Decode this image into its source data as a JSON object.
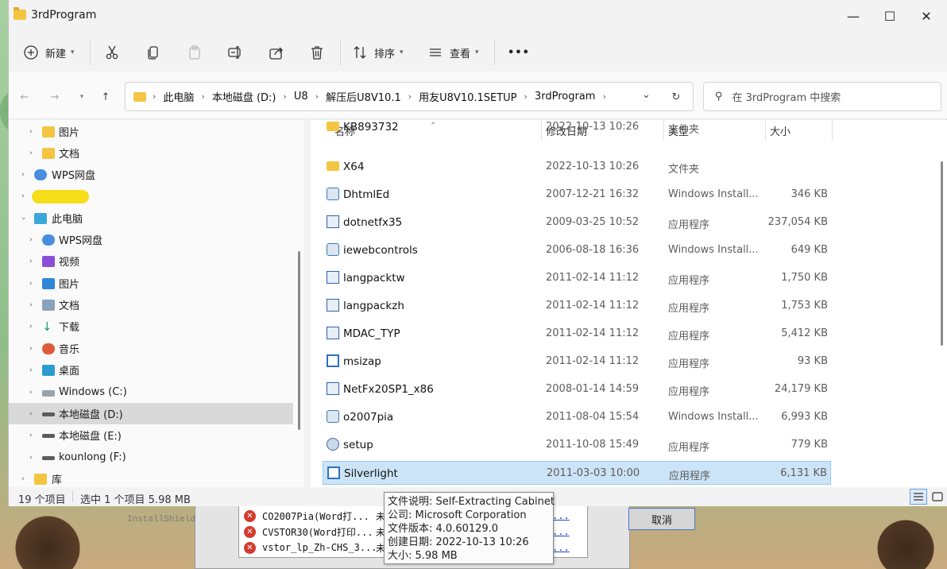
{
  "window": {
    "title": "3rdProgram"
  },
  "toolbar": {
    "new_label": "新建",
    "sort_label": "排序",
    "view_label": "查看",
    "more_label": "•••"
  },
  "address": {
    "crumbs": [
      "此电脑",
      "本地磁盘 (D:)",
      "U8",
      "解压后U8V10.1",
      "用友U8V10.1SETUP",
      "3rdProgram"
    ]
  },
  "search": {
    "placeholder": "在 3rdProgram 中搜索"
  },
  "sidebar": {
    "items": [
      {
        "label": "图片",
        "icon": "pictures-folder-icon"
      },
      {
        "label": "文档",
        "icon": "documents-folder-icon"
      },
      {
        "label": "WPS网盘",
        "icon": "wps-cloud-icon"
      },
      {
        "label": "",
        "icon": "user-icon"
      },
      {
        "label": "此电脑",
        "icon": "computer-icon"
      },
      {
        "label": "WPS网盘",
        "icon": "wps-cloud-icon"
      },
      {
        "label": "视频",
        "icon": "videos-icon"
      },
      {
        "label": "图片",
        "icon": "pictures-icon"
      },
      {
        "label": "文档",
        "icon": "documents-icon"
      },
      {
        "label": "下载",
        "icon": "download-icon"
      },
      {
        "label": "音乐",
        "icon": "music-icon"
      },
      {
        "label": "桌面",
        "icon": "desktop-icon"
      },
      {
        "label": "Windows  (C:)",
        "icon": "windows-drive-icon"
      },
      {
        "label": "本地磁盘 (D:)",
        "icon": "drive-icon"
      },
      {
        "label": "本地磁盘 (E:)",
        "icon": "drive-icon"
      },
      {
        "label": "kounlong (F:)",
        "icon": "drive-icon"
      },
      {
        "label": "库",
        "icon": "library-icon"
      }
    ]
  },
  "columns": {
    "name": "名称",
    "date": "修改日期",
    "type": "类型",
    "size": "大小"
  },
  "files": [
    {
      "name": "KB893732",
      "date": "2022-10-13 10:26",
      "type": "文件夹",
      "size": "",
      "icon": "folder-icon"
    },
    {
      "name": "X64",
      "date": "2022-10-13 10:26",
      "type": "文件夹",
      "size": "",
      "icon": "folder-icon"
    },
    {
      "name": "DhtmlEd",
      "date": "2007-12-21 16:32",
      "type": "Windows Install...",
      "size": "346 KB",
      "icon": "msi-icon"
    },
    {
      "name": "dotnetfx35",
      "date": "2009-03-25 10:52",
      "type": "应用程序",
      "size": "237,054 KB",
      "icon": "exe-icon"
    },
    {
      "name": "iewebcontrols",
      "date": "2006-08-18 16:36",
      "type": "Windows Install...",
      "size": "649 KB",
      "icon": "msi-icon"
    },
    {
      "name": "langpacktw",
      "date": "2011-02-14 11:12",
      "type": "应用程序",
      "size": "1,750 KB",
      "icon": "exe-icon"
    },
    {
      "name": "langpackzh",
      "date": "2011-02-14 11:12",
      "type": "应用程序",
      "size": "1,753 KB",
      "icon": "exe-icon"
    },
    {
      "name": "MDAC_TYP",
      "date": "2011-02-14 11:12",
      "type": "应用程序",
      "size": "5,412 KB",
      "icon": "exe-icon"
    },
    {
      "name": "msizap",
      "date": "2011-02-14 11:12",
      "type": "应用程序",
      "size": "93 KB",
      "icon": "app-icon"
    },
    {
      "name": "NetFx20SP1_x86",
      "date": "2008-01-14 14:59",
      "type": "应用程序",
      "size": "24,179 KB",
      "icon": "exe-icon"
    },
    {
      "name": "o2007pia",
      "date": "2011-08-04 15:54",
      "type": "Windows Install...",
      "size": "6,993 KB",
      "icon": "msi-icon"
    },
    {
      "name": "setup",
      "date": "2011-10-08 15:49",
      "type": "应用程序",
      "size": "779 KB",
      "icon": "setup-icon"
    },
    {
      "name": "Silverlight",
      "date": "2011-03-03 10:00",
      "type": "应用程序",
      "size": "6,131 KB",
      "icon": "app-icon"
    }
  ],
  "status": {
    "count": "19 个项目",
    "selection": "选中 1 个项目  5.98 MB"
  },
  "tooltip": {
    "lines": [
      "文件说明: Self-Extracting Cabinet",
      "公司: Microsoft Corporation",
      "文件版本: 4.0.60129.0",
      "创建日期: 2022-10-13 10:26",
      "大小: 5.98 MB"
    ]
  },
  "background_dialog": {
    "title": "InstallShield",
    "cancel_label": "取消",
    "errors": [
      {
        "name": "CO2007Pia(Word打...",
        "state": "未",
        "link": "..."
      },
      {
        "name": "CVSTOR30(Word打印...",
        "state": "未",
        "link": "..."
      },
      {
        "name": "vstor_lp_Zh-CHS_3...",
        "state": "未",
        "link": "..."
      }
    ]
  },
  "colors": {
    "selection": "#cce4f7",
    "accent": "#0067c0",
    "folder": "#f4c542"
  }
}
